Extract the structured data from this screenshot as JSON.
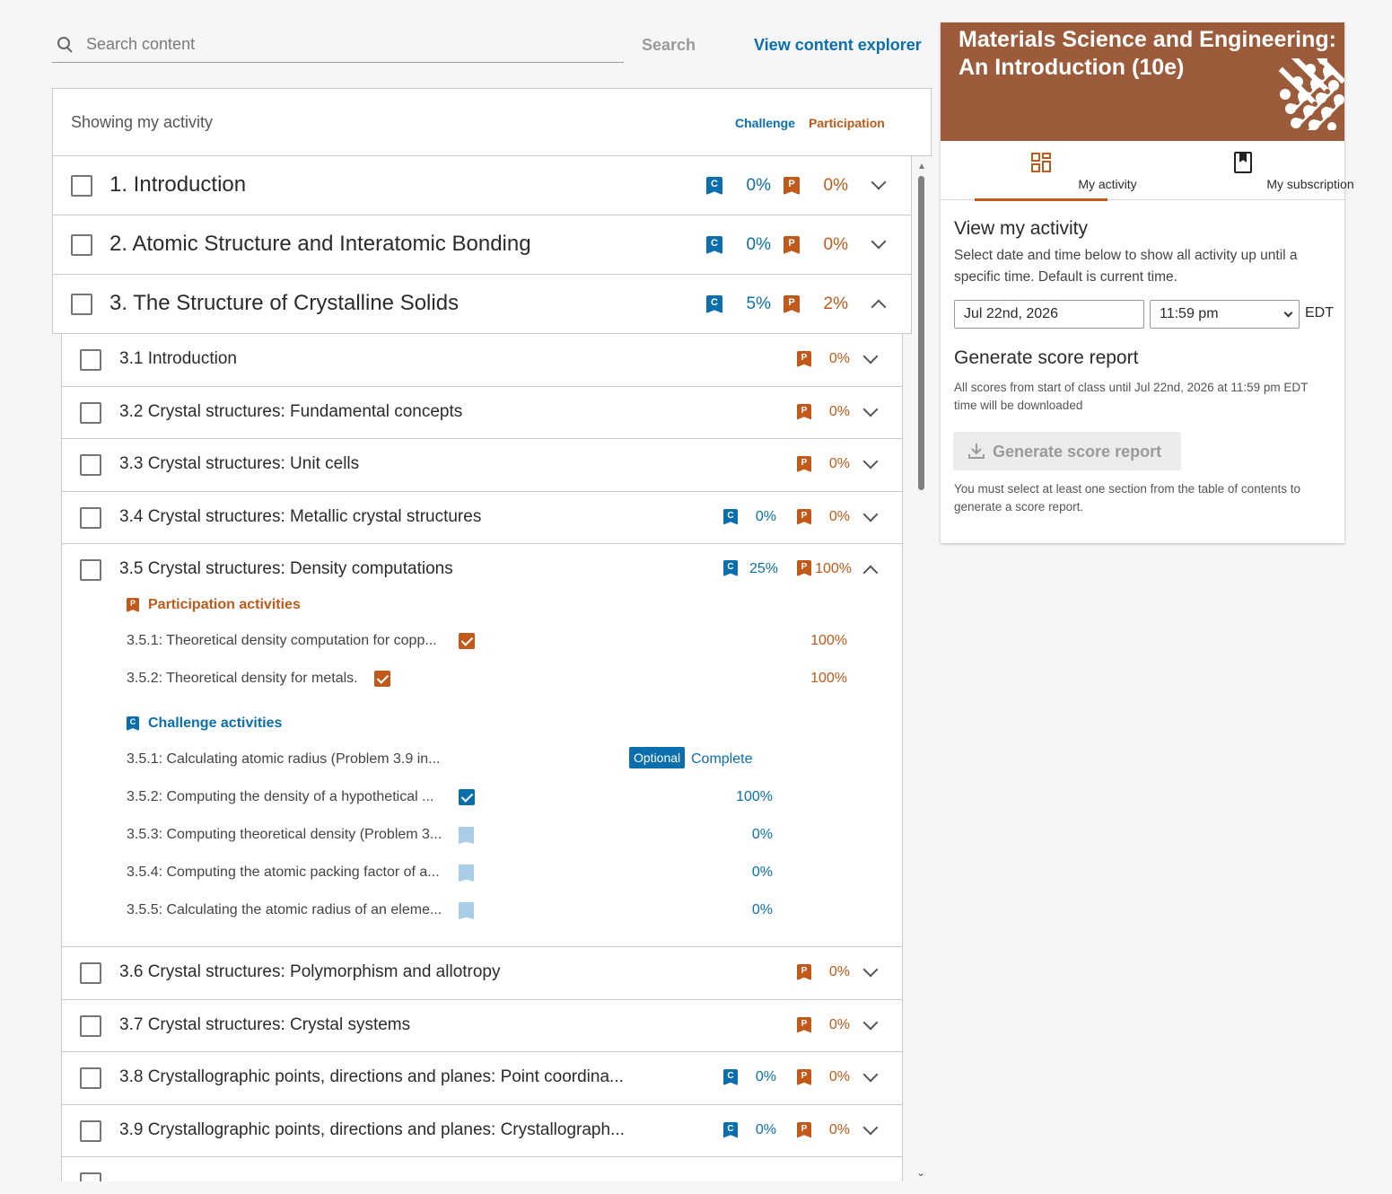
{
  "search": {
    "placeholder": "Search content",
    "button": "Search",
    "explorer_link": "View content explorer"
  },
  "toc": {
    "showing": "Showing my activity",
    "legend_challenge": "Challenge",
    "legend_participation": "Participation",
    "chapters": [
      {
        "title": "1. Introduction",
        "challenge": "0%",
        "participation": "0%",
        "expanded": false
      },
      {
        "title": "2. Atomic Structure and Interatomic Bonding",
        "challenge": "0%",
        "participation": "0%",
        "expanded": false
      },
      {
        "title": "3. The Structure of Crystalline Solids",
        "challenge": "5%",
        "participation": "2%",
        "expanded": true
      }
    ],
    "sections": [
      {
        "title": "3.1 Introduction",
        "challenge": "",
        "participation": "0%"
      },
      {
        "title": "3.2 Crystal structures: Fundamental concepts",
        "challenge": "",
        "participation": "0%"
      },
      {
        "title": "3.3 Crystal structures: Unit cells",
        "challenge": "",
        "participation": "0%"
      },
      {
        "title": "3.4 Crystal structures: Metallic crystal structures",
        "challenge": "0%",
        "participation": "0%"
      },
      {
        "title": "3.5 Crystal structures: Density computations",
        "challenge": "25%",
        "participation": "100%"
      },
      {
        "title": "3.6 Crystal structures: Polymorphism and allotropy",
        "challenge": "",
        "participation": "0%"
      },
      {
        "title": "3.7 Crystal structures: Crystal systems",
        "challenge": "",
        "participation": "0%"
      },
      {
        "title": "3.8 Crystallographic points, directions and planes: Point coordina...",
        "challenge": "0%",
        "participation": "0%"
      },
      {
        "title": "3.9 Crystallographic points, directions and planes: Crystallograph...",
        "challenge": "0%",
        "participation": "0%"
      }
    ],
    "expanded_section": {
      "participation_heading": "Participation activities",
      "participation": [
        {
          "title": "3.5.1: Theoretical density computation for copp...",
          "score": "100%"
        },
        {
          "title": "3.5.2: Theoretical density for metals.",
          "score": "100%"
        }
      ],
      "challenge_heading": "Challenge activities",
      "challenge": [
        {
          "title": "3.5.1: Calculating atomic radius (Problem 3.9 in...",
          "optional": "Optional",
          "status": "Complete"
        },
        {
          "title": "3.5.2: Computing the density of a hypothetical ...",
          "score": "100%"
        },
        {
          "title": "3.5.3: Computing theoretical density (Problem 3...",
          "score": "0%"
        },
        {
          "title": "3.5.4: Computing the atomic packing factor of a...",
          "score": "0%"
        },
        {
          "title": "3.5.5: Calculating the atomic radius of an eleme...",
          "score": "0%"
        }
      ]
    }
  },
  "panel": {
    "book_title": "Materials Science and Engineering: An Introduction (10e)",
    "tabs": [
      "My activity",
      "My subscription"
    ],
    "view_heading": "View my activity",
    "view_text": "Select date and time below to show all activity up until a specific time. Default is current time.",
    "date": "Jul 22nd, 2026",
    "time": "11:59 pm",
    "timezone": "EDT",
    "gen_heading": "Generate score report",
    "gen_text": "All scores from start of class until Jul 22nd, 2026 at 11:59 pm EDT time will be downloaded",
    "gen_button": "Generate score report",
    "gen_note": "You must select at least one section from the table of contents to generate a score report."
  },
  "badges": {
    "challenge": "C",
    "participation": "P"
  },
  "colors": {
    "challenge": "#0b6fad",
    "participation": "#c0591a",
    "banner": "#9c5c3c"
  }
}
